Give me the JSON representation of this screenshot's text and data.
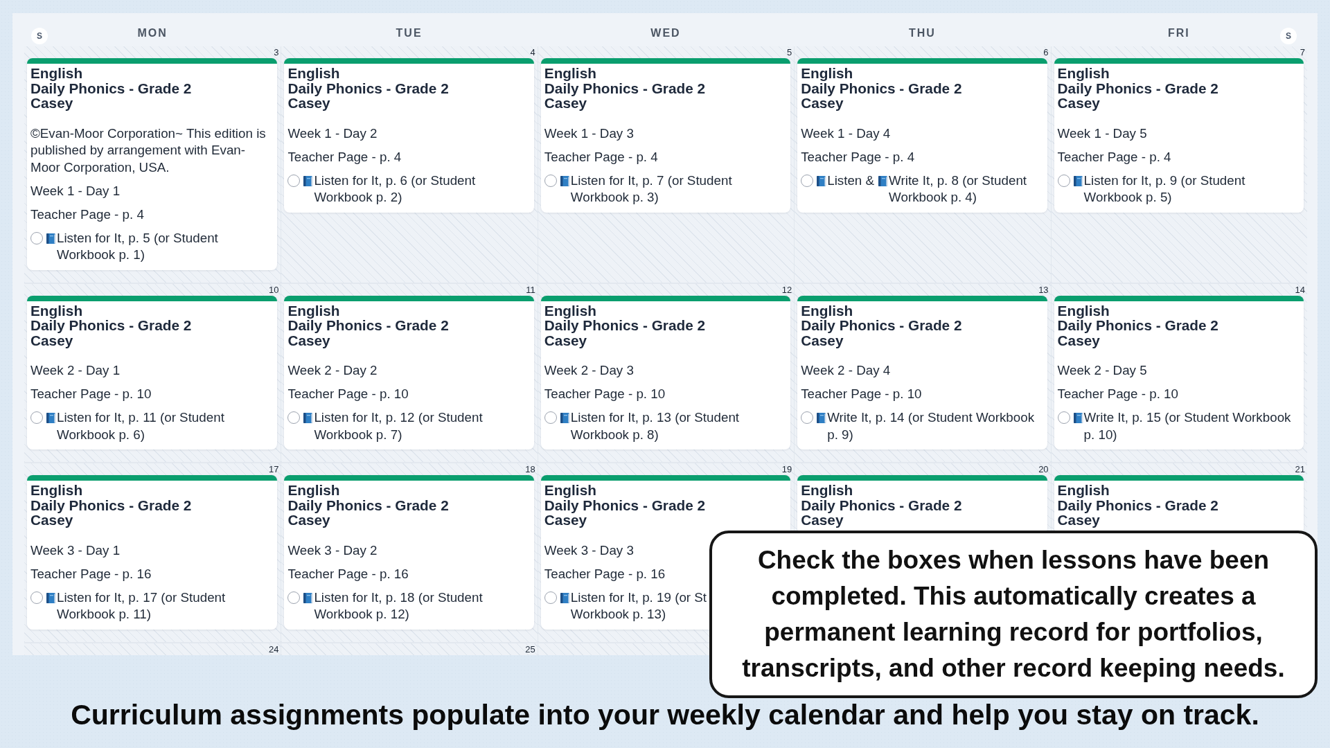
{
  "calendar": {
    "start_toggle": {
      "label": "S"
    },
    "day_headers": [
      "MON",
      "TUE",
      "WED",
      "THU",
      "FRI"
    ],
    "end_toggle": {
      "label": "S"
    },
    "weeks": [
      {
        "days": [
          {
            "date": "3",
            "card": {
              "subject": "English",
              "course": "Daily Phonics - Grade 2",
              "student": "Casey",
              "notes": [
                "©Evan-Moor Corporation~ This edition is published by arrangement with Evan-Moor Corporation, USA.",
                "Week 1 - Day 1",
                "Teacher Page - p. 4"
              ],
              "tasks": [
                {
                  "checked": false,
                  "parts": [
                    "Listen for It, p. 5 (or Student Workbook p. 1)"
                  ]
                }
              ]
            }
          },
          {
            "date": "4",
            "card": {
              "subject": "English",
              "course": "Daily Phonics - Grade 2",
              "student": "Casey",
              "notes": [
                "Week 1 - Day 2",
                "Teacher Page - p. 4"
              ],
              "tasks": [
                {
                  "checked": false,
                  "parts": [
                    "Listen for It, p. 6 (or Student Workbook p. 2)"
                  ]
                }
              ]
            }
          },
          {
            "date": "5",
            "card": {
              "subject": "English",
              "course": "Daily Phonics - Grade 2",
              "student": "Casey",
              "notes": [
                "Week 1 - Day 3",
                "Teacher Page - p. 4"
              ],
              "tasks": [
                {
                  "checked": false,
                  "parts": [
                    "Listen for It, p. 7 (or Student Workbook p. 3)"
                  ]
                }
              ]
            }
          },
          {
            "date": "6",
            "card": {
              "subject": "English",
              "course": "Daily Phonics - Grade 2",
              "student": "Casey",
              "notes": [
                "Week 1 - Day 4",
                "Teacher Page - p. 4"
              ],
              "tasks": [
                {
                  "checked": false,
                  "parts": [
                    "Listen &",
                    "Write It, p. 8 (or Student Workbook p. 4)"
                  ]
                }
              ]
            }
          },
          {
            "date": "7",
            "card": {
              "subject": "English",
              "course": "Daily Phonics - Grade 2",
              "student": "Casey",
              "notes": [
                "Week 1 - Day 5",
                "Teacher Page - p. 4"
              ],
              "tasks": [
                {
                  "checked": false,
                  "parts": [
                    "Listen for It, p. 9 (or Student Workbook p. 5)"
                  ]
                }
              ]
            }
          }
        ]
      },
      {
        "days": [
          {
            "date": "10",
            "card": {
              "subject": "English",
              "course": "Daily Phonics - Grade 2",
              "student": "Casey",
              "notes": [
                "Week 2 - Day 1",
                "Teacher Page - p. 10"
              ],
              "tasks": [
                {
                  "checked": false,
                  "parts": [
                    "Listen for It, p. 11 (or Student Workbook p. 6)"
                  ]
                }
              ]
            }
          },
          {
            "date": "11",
            "card": {
              "subject": "English",
              "course": "Daily Phonics - Grade 2",
              "student": "Casey",
              "notes": [
                "Week 2 - Day 2",
                "Teacher Page - p. 10"
              ],
              "tasks": [
                {
                  "checked": false,
                  "parts": [
                    "Listen for It, p. 12 (or Student Workbook p. 7)"
                  ]
                }
              ]
            }
          },
          {
            "date": "12",
            "card": {
              "subject": "English",
              "course": "Daily Phonics - Grade 2",
              "student": "Casey",
              "notes": [
                "Week 2 - Day 3",
                "Teacher Page - p. 10"
              ],
              "tasks": [
                {
                  "checked": false,
                  "parts": [
                    "Listen for It, p. 13 (or Student Workbook p. 8)"
                  ]
                }
              ]
            }
          },
          {
            "date": "13",
            "card": {
              "subject": "English",
              "course": "Daily Phonics - Grade 2",
              "student": "Casey",
              "notes": [
                "Week 2 - Day 4",
                "Teacher Page - p. 10"
              ],
              "tasks": [
                {
                  "checked": false,
                  "parts": [
                    "Write It, p. 14 (or Student Workbook p. 9)"
                  ]
                }
              ]
            }
          },
          {
            "date": "14",
            "card": {
              "subject": "English",
              "course": "Daily Phonics - Grade 2",
              "student": "Casey",
              "notes": [
                "Week 2 - Day 5",
                "Teacher Page - p. 10"
              ],
              "tasks": [
                {
                  "checked": false,
                  "parts": [
                    "Write It, p. 15 (or Student Workbook p. 10)"
                  ]
                }
              ]
            }
          }
        ]
      },
      {
        "days": [
          {
            "date": "17",
            "card": {
              "subject": "English",
              "course": "Daily Phonics - Grade 2",
              "student": "Casey",
              "notes": [
                "Week 3 - Day 1",
                "Teacher Page - p. 16"
              ],
              "tasks": [
                {
                  "checked": false,
                  "parts": [
                    "Listen for It, p. 17 (or Student Workbook p. 11)"
                  ]
                }
              ]
            }
          },
          {
            "date": "18",
            "card": {
              "subject": "English",
              "course": "Daily Phonics - Grade 2",
              "student": "Casey",
              "notes": [
                "Week 3 - Day 2",
                "Teacher Page - p. 16"
              ],
              "tasks": [
                {
                  "checked": false,
                  "parts": [
                    "Listen for It, p. 18 (or Student Workbook p. 12)"
                  ]
                }
              ]
            }
          },
          {
            "date": "19",
            "card": {
              "subject": "English",
              "course": "Daily Phonics - Grade 2",
              "student": "Casey",
              "notes": [
                "Week 3 - Day 3",
                "Teacher Page - p. 16"
              ],
              "tasks": [
                {
                  "checked": false,
                  "parts": [
                    "Listen for It, p. 19 (or St\nWorkbook p. 13)"
                  ]
                }
              ]
            }
          },
          {
            "date": "20",
            "card": {
              "subject": "English",
              "course": "Daily Phonics - Grade 2",
              "student": "Casey"
            }
          },
          {
            "date": "21",
            "card": {
              "subject": "English",
              "course": "Daily Phonics - Grade 2",
              "student": "Casey"
            }
          }
        ]
      },
      {
        "days": [
          {
            "date": "24"
          },
          {
            "date": "25"
          }
        ]
      }
    ]
  },
  "callout": {
    "text": "Check the boxes when lessons have been completed. This automatically creates a permanent learning record for portfolios, transcripts, and other record keeping needs."
  },
  "caption": "Curriculum assignments populate into your weekly calendar and help you stay on track."
}
